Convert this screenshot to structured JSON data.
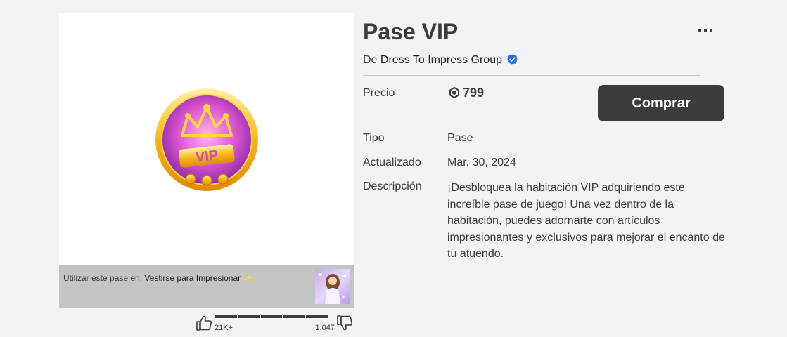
{
  "item": {
    "title": "Pase VIP",
    "creator_prefix": "De",
    "creator_name": "Dress To Impress Group",
    "price_label": "Precio",
    "price_value": "799",
    "buy_label": "Comprar",
    "type_label": "Tipo",
    "type_value": "Pase",
    "updated_label": "Actualizado",
    "updated_value": "Mar. 30, 2024",
    "description_label": "Descripción",
    "description": "¡Desbloquea la habitación VIP adquiriendo este increíble pase de juego! Una vez dentro de la habitación, puedes adornarte con artículos impresionantes y exclusivos para mejorar el encanto de tu atuendo.",
    "icon_text": "VIP"
  },
  "place": {
    "prefix": "Utilizar este pase en:",
    "name": "Vestirse para Impresionar",
    "sparkle": "✨"
  },
  "votes": {
    "up": "21K+",
    "down": "1,047",
    "up_fraction": 0.95
  },
  "colors": {
    "background": "#f2f3f5",
    "button": "#393b3d",
    "verified": "#1e6ee6"
  }
}
